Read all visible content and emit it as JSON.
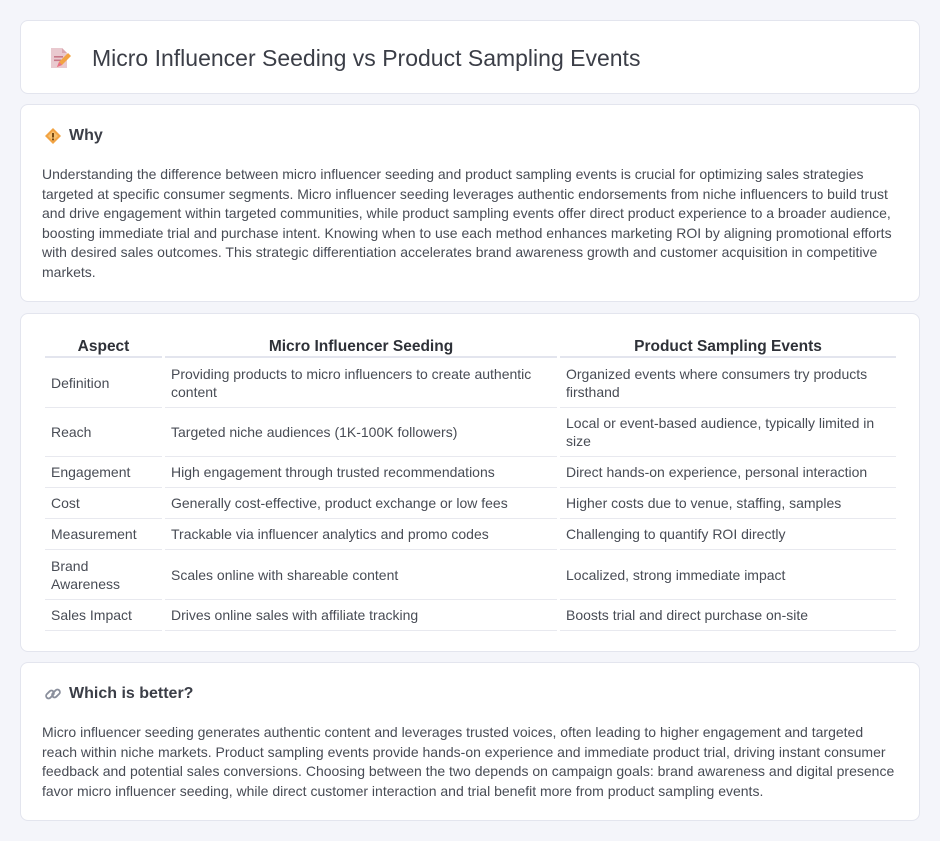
{
  "header": {
    "title": "Micro Influencer Seeding vs Product Sampling Events"
  },
  "why": {
    "heading": "Why",
    "text": "Understanding the difference between micro influencer seeding and product sampling events is crucial for optimizing sales strategies targeted at specific consumer segments. Micro influencer seeding leverages authentic endorsements from niche influencers to build trust and drive engagement within targeted communities, while product sampling events offer direct product experience to a broader audience, boosting immediate trial and purchase intent. Knowing when to use each method enhances marketing ROI by aligning promotional efforts with desired sales outcomes. This strategic differentiation accelerates brand awareness growth and customer acquisition in competitive markets."
  },
  "table": {
    "headers": [
      "Aspect",
      "Micro Influencer Seeding",
      "Product Sampling Events"
    ],
    "rows": [
      [
        "Definition",
        "Providing products to micro influencers to create authentic content",
        "Organized events where consumers try products firsthand"
      ],
      [
        "Reach",
        "Targeted niche audiences (1K-100K followers)",
        "Local or event-based audience, typically limited in size"
      ],
      [
        "Engagement",
        "High engagement through trusted recommendations",
        "Direct hands-on experience, personal interaction"
      ],
      [
        "Cost",
        "Generally cost-effective, product exchange or low fees",
        "Higher costs due to venue, staffing, samples"
      ],
      [
        "Measurement",
        "Trackable via influencer analytics and promo codes",
        "Challenging to quantify ROI directly"
      ],
      [
        "Brand Awareness",
        "Scales online with shareable content",
        "Localized, strong immediate impact"
      ],
      [
        "Sales Impact",
        "Drives online sales with affiliate tracking",
        "Boosts trial and direct purchase on-site"
      ]
    ]
  },
  "better": {
    "heading": "Which is better?",
    "text": "Micro influencer seeding generates authentic content and leverages trusted voices, often leading to higher engagement and targeted reach within niche markets. Product sampling events provide hands-on experience and immediate product trial, driving instant consumer feedback and potential sales conversions. Choosing between the two depends on campaign goals: brand awareness and digital presence favor micro influencer seeding, while direct customer interaction and trial benefit more from product sampling events."
  },
  "icons": {
    "header": "document-pen-icon",
    "why": "diamond-sign-icon",
    "better": "link-icon"
  },
  "colors": {
    "background": "#f4f5fa",
    "card": "#ffffff",
    "accent_orange": "#f0a040",
    "accent_pink": "#e8708a"
  }
}
